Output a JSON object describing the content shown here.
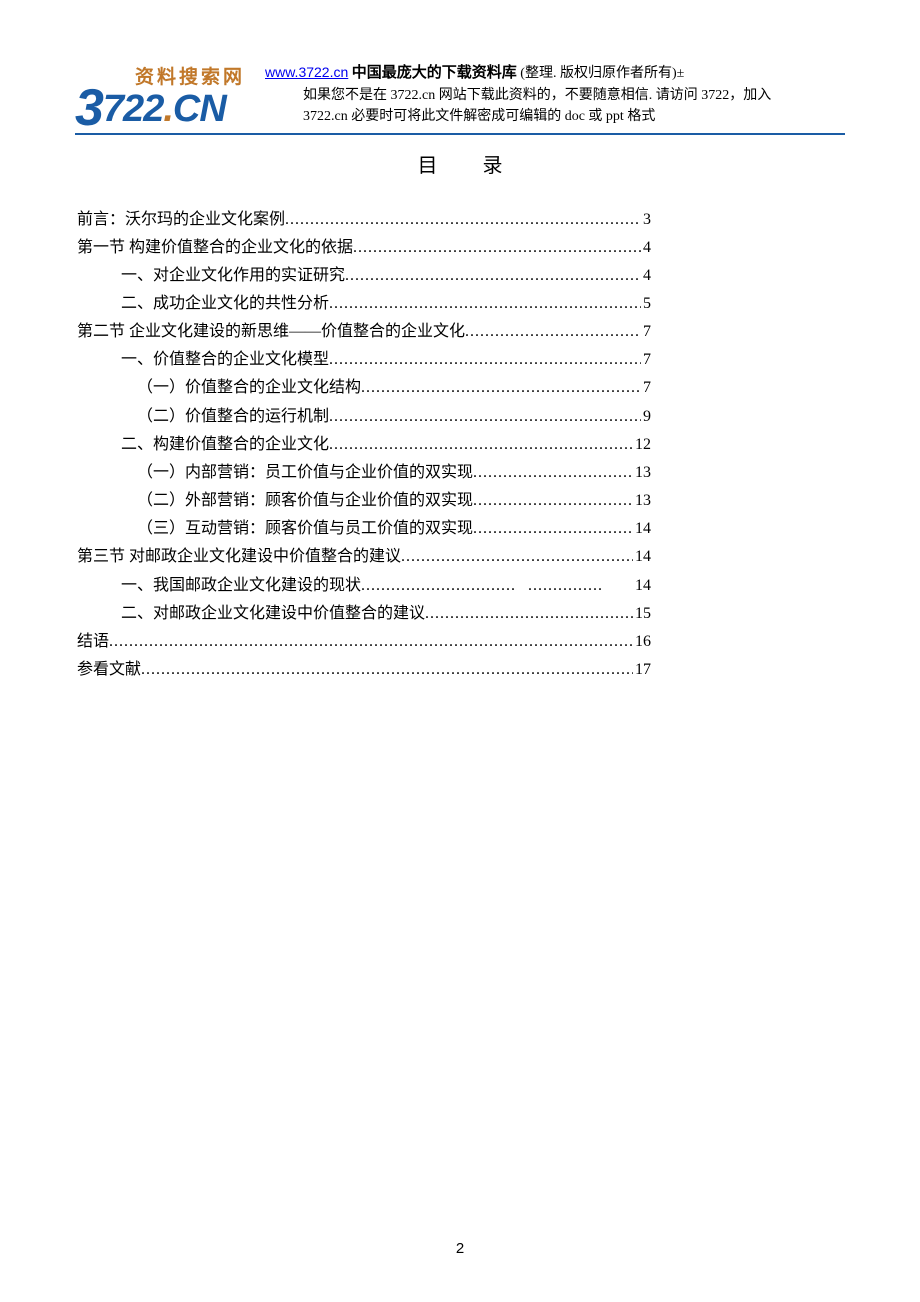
{
  "header": {
    "logo": {
      "top_text": "资料搜索网",
      "main_text_3": "3",
      "main_text_722": "722",
      "main_text_cn": "CN"
    },
    "link": "www.3722.cn",
    "title": "中国最庞大的下载资料库",
    "suffix": "(整理. 版权归原作者所有)±",
    "line2": "如果您不是在 3722.cn 网站下载此资料的，不要随意相信. 请访问 3722，加入",
    "line3": "3722.cn 必要时可将此文件解密成可编辑的 doc 或 ppt 格式"
  },
  "toc_title": "目录",
  "toc": [
    {
      "label": "前言：沃尔玛的企业文化案例",
      "page": "3",
      "indent": 0
    },
    {
      "label": "第一节   构建价值整合的企业文化的依据",
      "page": "4",
      "indent": 0
    },
    {
      "label": "一、对企业文化作用的实证研究",
      "page": "4",
      "indent": 1
    },
    {
      "label": "二、成功企业文化的共性分析",
      "page": "5",
      "indent": 1
    },
    {
      "label": "第二节   企业文化建设的新思维——价值整合的企业文化",
      "page": "7",
      "indent": 0
    },
    {
      "label": "一、价值整合的企业文化模型",
      "page": "7",
      "indent": 1
    },
    {
      "label": "（一）价值整合的企业文化结构",
      "page": "7",
      "indent": 2
    },
    {
      "label": "（二）价值整合的运行机制",
      "page": "9",
      "indent": 2
    },
    {
      "label": "二、构建价值整合的企业文化",
      "page": "12",
      "indent": 1
    },
    {
      "label": "（一）内部营销：员工价值与企业价值的双实现",
      "page": "13",
      "indent": 2
    },
    {
      "label": "（二）外部营销：顾客价值与企业价值的双实现",
      "page": "13",
      "indent": 2
    },
    {
      "label": "（三）互动营销：顾客价值与员工价值的双实现",
      "page": "14",
      "indent": 2
    },
    {
      "label": "第三节   对邮政企业文化建设中价值整合的建议",
      "page": "14",
      "indent": 0
    },
    {
      "label": "一、我国邮政企业文化建设的现状",
      "page": "14",
      "indent": 1,
      "special": "spaced"
    },
    {
      "label": "二、对邮政企业文化建设中价值整合的建议",
      "page": "15",
      "indent": 1
    },
    {
      "label": "结语",
      "page": "16",
      "indent": 0
    },
    {
      "label": "参看文献",
      "page": "17",
      "indent": 0
    }
  ],
  "page_number": "2"
}
